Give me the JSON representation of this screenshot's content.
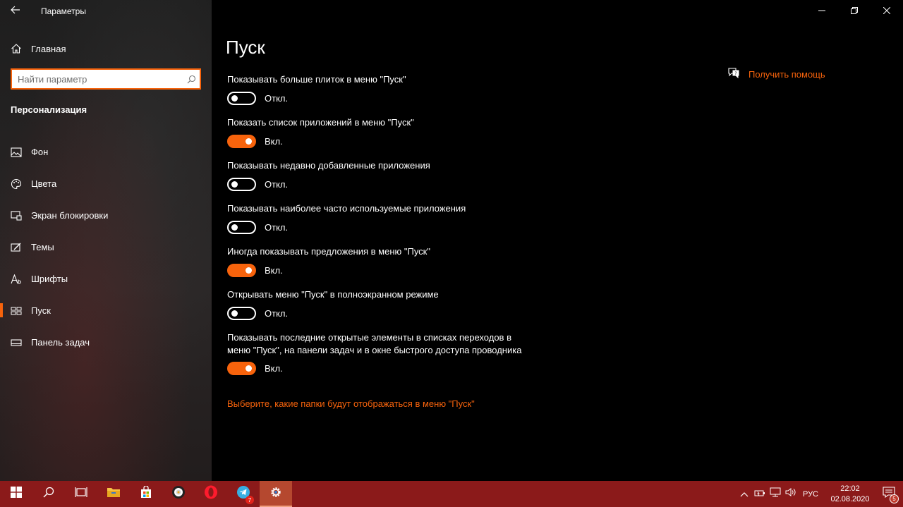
{
  "window": {
    "title": "Параметры",
    "controls": {
      "minimize": "minimize-icon",
      "maximize": "restore-icon",
      "close": "close-icon"
    }
  },
  "sidebar": {
    "home_label": "Главная",
    "search_placeholder": "Найти параметр",
    "section_heading": "Персонализация",
    "items": [
      {
        "label": "Фон",
        "icon": "picture-icon",
        "active": false
      },
      {
        "label": "Цвета",
        "icon": "palette-icon",
        "active": false
      },
      {
        "label": "Экран блокировки",
        "icon": "lock-screen-icon",
        "active": false
      },
      {
        "label": "Темы",
        "icon": "brush-icon",
        "active": false
      },
      {
        "label": "Шрифты",
        "icon": "font-icon",
        "active": false
      },
      {
        "label": "Пуск",
        "icon": "start-icon",
        "active": true
      },
      {
        "label": "Панель задач",
        "icon": "taskbar-icon",
        "active": false
      }
    ]
  },
  "main": {
    "title": "Пуск",
    "settings": [
      {
        "label": "Показывать больше плиток в меню \"Пуск\"",
        "state": "Откл.",
        "on": false
      },
      {
        "label": "Показать список приложений в меню \"Пуск\"",
        "state": "Вкл.",
        "on": true
      },
      {
        "label": "Показывать недавно добавленные приложения",
        "state": "Откл.",
        "on": false
      },
      {
        "label": "Показывать наиболее часто используемые приложения",
        "state": "Откл.",
        "on": false
      },
      {
        "label": "Иногда показывать предложения в меню \"Пуск\"",
        "state": "Вкл.",
        "on": true
      },
      {
        "label": "Открывать меню \"Пуск\" в полноэкранном режиме",
        "state": "Откл.",
        "on": false
      },
      {
        "label": "Показывать последние открытые элементы в списках переходов в меню \"Пуск\", на панели задач и в окне быстрого доступа проводника",
        "state": "Вкл.",
        "on": true
      }
    ],
    "folders_link": "Выберите, какие папки будут отображаться в меню \"Пуск\"",
    "help_label": "Получить помощь"
  },
  "taskbar": {
    "pinned": [
      {
        "icon": "windows-start-icon"
      },
      {
        "icon": "search-icon"
      },
      {
        "icon": "task-view-icon"
      },
      {
        "icon": "file-explorer-icon"
      },
      {
        "icon": "store-icon"
      },
      {
        "icon": "media-player-icon"
      },
      {
        "icon": "opera-icon"
      },
      {
        "icon": "telegram-icon",
        "badge": "7"
      },
      {
        "icon": "settings-gear-icon",
        "active": true
      }
    ],
    "tray": {
      "language": "РУС",
      "time": "22:02",
      "date": "02.08.2020",
      "notification_count": "5"
    }
  },
  "colors": {
    "accent": "#f7630c",
    "taskbar": "#8b1a1a",
    "background": "#000000"
  }
}
